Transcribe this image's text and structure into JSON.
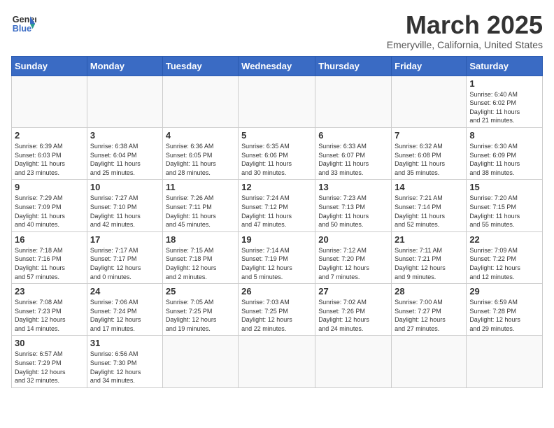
{
  "header": {
    "logo_line1": "General",
    "logo_line2": "Blue",
    "month": "March 2025",
    "location": "Emeryville, California, United States"
  },
  "days_of_week": [
    "Sunday",
    "Monday",
    "Tuesday",
    "Wednesday",
    "Thursday",
    "Friday",
    "Saturday"
  ],
  "weeks": [
    [
      {
        "day": "",
        "info": ""
      },
      {
        "day": "",
        "info": ""
      },
      {
        "day": "",
        "info": ""
      },
      {
        "day": "",
        "info": ""
      },
      {
        "day": "",
        "info": ""
      },
      {
        "day": "",
        "info": ""
      },
      {
        "day": "1",
        "info": "Sunrise: 6:40 AM\nSunset: 6:02 PM\nDaylight: 11 hours\nand 21 minutes."
      }
    ],
    [
      {
        "day": "2",
        "info": "Sunrise: 6:39 AM\nSunset: 6:03 PM\nDaylight: 11 hours\nand 23 minutes."
      },
      {
        "day": "3",
        "info": "Sunrise: 6:38 AM\nSunset: 6:04 PM\nDaylight: 11 hours\nand 25 minutes."
      },
      {
        "day": "4",
        "info": "Sunrise: 6:36 AM\nSunset: 6:05 PM\nDaylight: 11 hours\nand 28 minutes."
      },
      {
        "day": "5",
        "info": "Sunrise: 6:35 AM\nSunset: 6:06 PM\nDaylight: 11 hours\nand 30 minutes."
      },
      {
        "day": "6",
        "info": "Sunrise: 6:33 AM\nSunset: 6:07 PM\nDaylight: 11 hours\nand 33 minutes."
      },
      {
        "day": "7",
        "info": "Sunrise: 6:32 AM\nSunset: 6:08 PM\nDaylight: 11 hours\nand 35 minutes."
      },
      {
        "day": "8",
        "info": "Sunrise: 6:30 AM\nSunset: 6:09 PM\nDaylight: 11 hours\nand 38 minutes."
      }
    ],
    [
      {
        "day": "9",
        "info": "Sunrise: 7:29 AM\nSunset: 7:09 PM\nDaylight: 11 hours\nand 40 minutes."
      },
      {
        "day": "10",
        "info": "Sunrise: 7:27 AM\nSunset: 7:10 PM\nDaylight: 11 hours\nand 42 minutes."
      },
      {
        "day": "11",
        "info": "Sunrise: 7:26 AM\nSunset: 7:11 PM\nDaylight: 11 hours\nand 45 minutes."
      },
      {
        "day": "12",
        "info": "Sunrise: 7:24 AM\nSunset: 7:12 PM\nDaylight: 11 hours\nand 47 minutes."
      },
      {
        "day": "13",
        "info": "Sunrise: 7:23 AM\nSunset: 7:13 PM\nDaylight: 11 hours\nand 50 minutes."
      },
      {
        "day": "14",
        "info": "Sunrise: 7:21 AM\nSunset: 7:14 PM\nDaylight: 11 hours\nand 52 minutes."
      },
      {
        "day": "15",
        "info": "Sunrise: 7:20 AM\nSunset: 7:15 PM\nDaylight: 11 hours\nand 55 minutes."
      }
    ],
    [
      {
        "day": "16",
        "info": "Sunrise: 7:18 AM\nSunset: 7:16 PM\nDaylight: 11 hours\nand 57 minutes."
      },
      {
        "day": "17",
        "info": "Sunrise: 7:17 AM\nSunset: 7:17 PM\nDaylight: 12 hours\nand 0 minutes."
      },
      {
        "day": "18",
        "info": "Sunrise: 7:15 AM\nSunset: 7:18 PM\nDaylight: 12 hours\nand 2 minutes."
      },
      {
        "day": "19",
        "info": "Sunrise: 7:14 AM\nSunset: 7:19 PM\nDaylight: 12 hours\nand 5 minutes."
      },
      {
        "day": "20",
        "info": "Sunrise: 7:12 AM\nSunset: 7:20 PM\nDaylight: 12 hours\nand 7 minutes."
      },
      {
        "day": "21",
        "info": "Sunrise: 7:11 AM\nSunset: 7:21 PM\nDaylight: 12 hours\nand 9 minutes."
      },
      {
        "day": "22",
        "info": "Sunrise: 7:09 AM\nSunset: 7:22 PM\nDaylight: 12 hours\nand 12 minutes."
      }
    ],
    [
      {
        "day": "23",
        "info": "Sunrise: 7:08 AM\nSunset: 7:23 PM\nDaylight: 12 hours\nand 14 minutes."
      },
      {
        "day": "24",
        "info": "Sunrise: 7:06 AM\nSunset: 7:24 PM\nDaylight: 12 hours\nand 17 minutes."
      },
      {
        "day": "25",
        "info": "Sunrise: 7:05 AM\nSunset: 7:25 PM\nDaylight: 12 hours\nand 19 minutes."
      },
      {
        "day": "26",
        "info": "Sunrise: 7:03 AM\nSunset: 7:25 PM\nDaylight: 12 hours\nand 22 minutes."
      },
      {
        "day": "27",
        "info": "Sunrise: 7:02 AM\nSunset: 7:26 PM\nDaylight: 12 hours\nand 24 minutes."
      },
      {
        "day": "28",
        "info": "Sunrise: 7:00 AM\nSunset: 7:27 PM\nDaylight: 12 hours\nand 27 minutes."
      },
      {
        "day": "29",
        "info": "Sunrise: 6:59 AM\nSunset: 7:28 PM\nDaylight: 12 hours\nand 29 minutes."
      }
    ],
    [
      {
        "day": "30",
        "info": "Sunrise: 6:57 AM\nSunset: 7:29 PM\nDaylight: 12 hours\nand 32 minutes."
      },
      {
        "day": "31",
        "info": "Sunrise: 6:56 AM\nSunset: 7:30 PM\nDaylight: 12 hours\nand 34 minutes."
      },
      {
        "day": "",
        "info": ""
      },
      {
        "day": "",
        "info": ""
      },
      {
        "day": "",
        "info": ""
      },
      {
        "day": "",
        "info": ""
      },
      {
        "day": "",
        "info": ""
      }
    ]
  ]
}
